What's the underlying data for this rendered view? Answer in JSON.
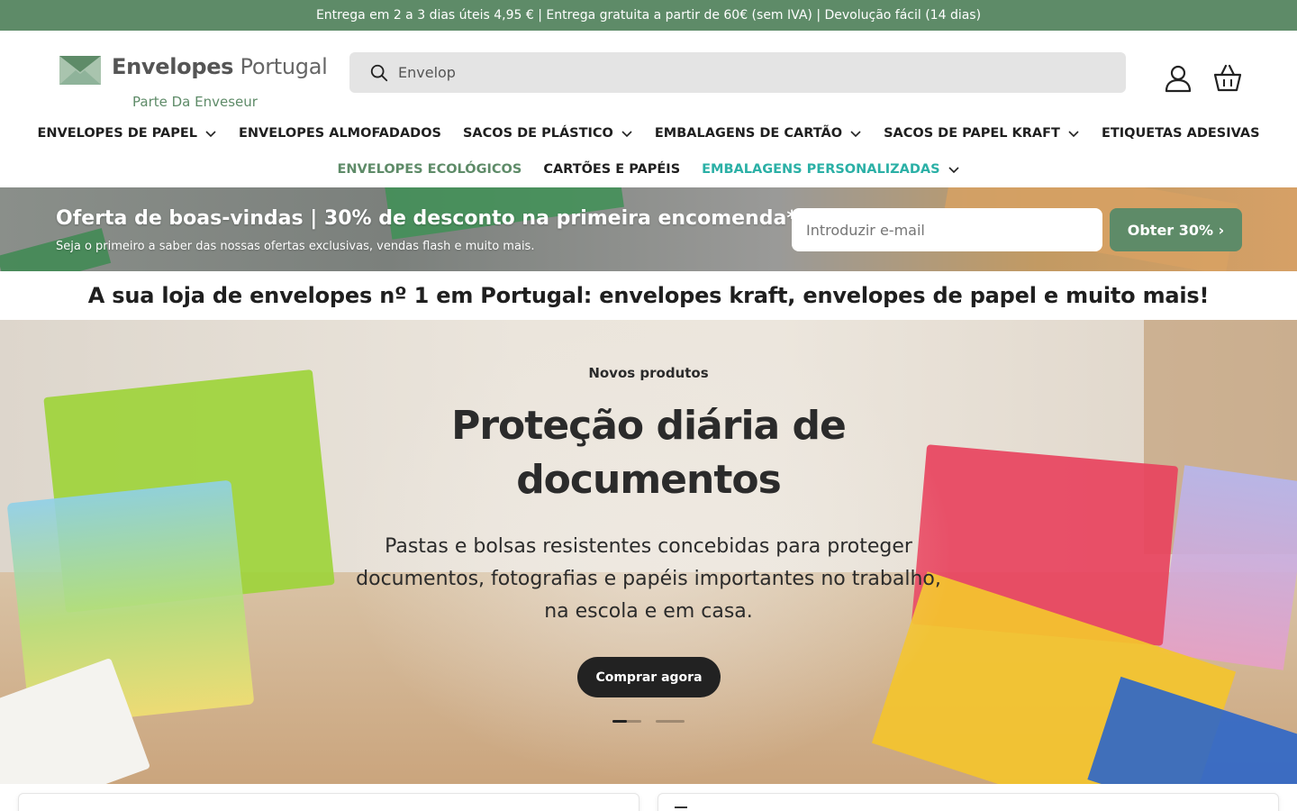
{
  "announcement": "Entrega em 2 a 3 dias úteis 4,95 € | Entrega gratuita a partir de 60€ (sem IVA) | Devolução fácil (14 dias)",
  "brand": {
    "name_bold": "Envelopes",
    "name_light": "Portugal",
    "tagline": "Parte Da Enveseur",
    "logo_color": "#7fa889"
  },
  "search": {
    "value": "Envelop",
    "icon": "search-icon"
  },
  "header_icons": [
    "account-icon",
    "cart-icon"
  ],
  "nav": {
    "row1": [
      {
        "label": "ENVELOPES DE PAPEL",
        "dropdown": true
      },
      {
        "label": "ENVELOPES ALMOFADADOS",
        "dropdown": false
      },
      {
        "label": "SACOS DE PLÁSTICO",
        "dropdown": true
      },
      {
        "label": "EMBALAGENS DE CARTÃO",
        "dropdown": true
      },
      {
        "label": "SACOS DE PAPEL KRAFT",
        "dropdown": true
      },
      {
        "label": "ETIQUETAS ADESIVAS",
        "dropdown": false
      }
    ],
    "row2": [
      {
        "label": "ENVELOPES ECOLÓGICOS",
        "dropdown": false,
        "color": "#5e8b68"
      },
      {
        "label": "CARTÕES E PAPÉIS",
        "dropdown": false
      },
      {
        "label": "EMBALAGENS PERSONALIZADAS",
        "dropdown": true,
        "color": "#2bb0a6"
      }
    ]
  },
  "promo": {
    "title": "Oferta de boas-vindas | 30% de desconto na primeira encomenda*",
    "subtitle": "Seja o primeiro a saber das nossas ofertas exclusivas, vendas flash e muito mais.",
    "email_placeholder": "Introduzir e-mail",
    "button": "Obter 30% ›"
  },
  "tagline": "A sua loja de envelopes nº 1 em Portugal: envelopes kraft, envelopes de papel e muito mais!",
  "hero": {
    "kicker": "Novos produtos",
    "heading": "Proteção diária de documentos",
    "description": "Pastas e bolsas resistentes concebidas para proteger documentos, fotografias e papéis importantes no trabalho, na escola e em casa.",
    "button": "Comprar agora",
    "slides": 2,
    "active_slide": 1
  },
  "colors": {
    "accent": "#5e8b68",
    "teal": "#2bb0a6",
    "dark": "#222222"
  }
}
